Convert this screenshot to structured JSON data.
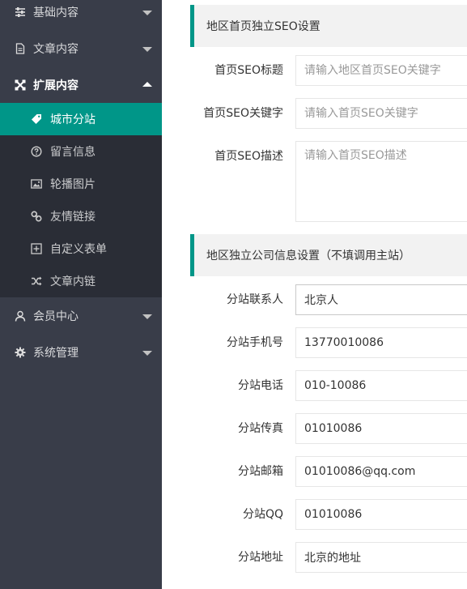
{
  "sidebar": {
    "groups": [
      {
        "label": "基础内容",
        "icon": "sliders-icon"
      },
      {
        "label": "文章内容",
        "icon": "document-icon"
      },
      {
        "label": "扩展内容",
        "icon": "expand-icon"
      },
      {
        "label": "会员中心",
        "icon": "user-icon"
      },
      {
        "label": "系统管理",
        "icon": "gear-icon"
      }
    ],
    "sub_items": [
      {
        "label": "城市分站",
        "icon": "tag-icon"
      },
      {
        "label": "留言信息",
        "icon": "question-circle-icon"
      },
      {
        "label": "轮播图片",
        "icon": "image-icon"
      },
      {
        "label": "友情链接",
        "icon": "link-icon"
      },
      {
        "label": "自定义表单",
        "icon": "plus-square-icon"
      },
      {
        "label": "文章内链",
        "icon": "shuffle-icon"
      }
    ],
    "active_sub_item": "城市分站",
    "accent": "#009688"
  },
  "seo_section": {
    "title": "地区首页独立SEO设置",
    "fields": [
      {
        "label": "首页SEO标题",
        "value": "",
        "placeholder": "请输入地区首页SEO关键字"
      },
      {
        "label": "首页SEO关键字",
        "value": "",
        "placeholder": "请输入首页SEO关键字"
      },
      {
        "label": "首页SEO描述",
        "value": "",
        "placeholder": "请输入首页SEO描述"
      }
    ]
  },
  "company_section": {
    "title": "地区独立公司信息设置（不填调用主站）",
    "fields": [
      {
        "label": "分站联系人",
        "value": "北京人"
      },
      {
        "label": "分站手机号",
        "value": "13770010086"
      },
      {
        "label": "分站电话",
        "value": "010-10086"
      },
      {
        "label": "分站传真",
        "value": "01010086"
      },
      {
        "label": "分站邮箱",
        "value": "01010086@qq.com"
      },
      {
        "label": "分站QQ",
        "value": "01010086"
      },
      {
        "label": "分站地址",
        "value": "北京的地址"
      }
    ]
  }
}
